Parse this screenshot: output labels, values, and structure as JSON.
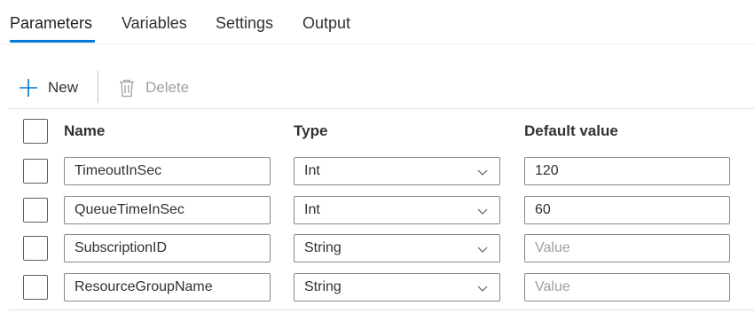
{
  "tabs": [
    {
      "label": "Parameters",
      "active": true
    },
    {
      "label": "Variables"
    },
    {
      "label": "Settings"
    },
    {
      "label": "Output"
    }
  ],
  "toolbar": {
    "new_label": "New",
    "delete_label": "Delete"
  },
  "table": {
    "columns": {
      "name": "Name",
      "type": "Type",
      "default": "Default value"
    },
    "default_placeholder": "Value",
    "rows": [
      {
        "name": "TimeoutInSec",
        "type": "Int",
        "default": "120"
      },
      {
        "name": "QueueTimeInSec",
        "type": "Int",
        "default": "60"
      },
      {
        "name": "SubscriptionID",
        "type": "String",
        "default": ""
      },
      {
        "name": "ResourceGroupName",
        "type": "String",
        "default": ""
      }
    ]
  },
  "colors": {
    "accent": "#0078d4",
    "text": "#323130",
    "disabled": "#a19f9d",
    "border": "#8a8886"
  },
  "icons": {
    "new": "plus-icon",
    "delete": "trash-icon",
    "dropdown": "chevron-down-icon"
  }
}
